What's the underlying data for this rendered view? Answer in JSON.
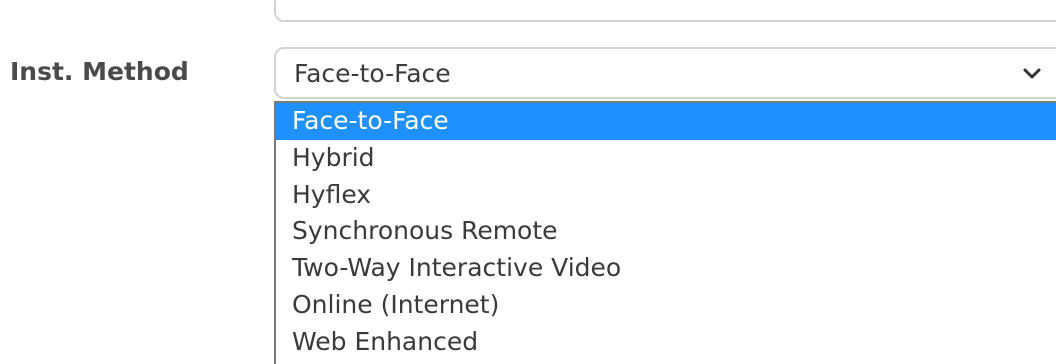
{
  "form": {
    "inst_method_label": "Inst. Method",
    "inst_method_value": "Face-to-Face",
    "selected_bg": "#1e90ff",
    "icons": {
      "dropdown": "chevron-down-icon"
    },
    "options": [
      {
        "label": "Face-to-Face",
        "selected": true
      },
      {
        "label": "Hybrid",
        "selected": false
      },
      {
        "label": "Hyflex",
        "selected": false
      },
      {
        "label": "Synchronous Remote",
        "selected": false
      },
      {
        "label": "Two-Way Interactive Video",
        "selected": false
      },
      {
        "label": "Online (Internet)",
        "selected": false
      },
      {
        "label": "Web Enhanced",
        "selected": false
      }
    ]
  }
}
